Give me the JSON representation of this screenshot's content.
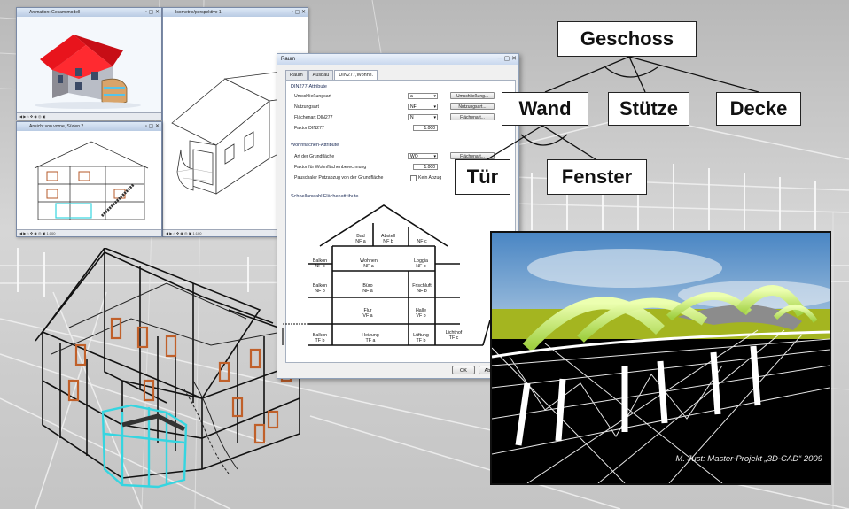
{
  "windows": {
    "top_left_title": "Animation: Gesamtmodell",
    "top_right_title": "Isometrie/perspektive 1",
    "bottom_left_title": "Ansicht von vorne, Süden 2",
    "status_scale": "1:100"
  },
  "dialog": {
    "title": "Raum",
    "tabs": [
      "Raum",
      "Ausbau",
      "DIN277,Wohnfl."
    ],
    "din_section": "DIN277-Attribute",
    "rows": [
      {
        "label": "Umschließungsart",
        "value": "a",
        "button": "Umschließung..."
      },
      {
        "label": "Nutzungsart",
        "value": "NF",
        "button": "Nutzungsart..."
      },
      {
        "label": "Flächenart DIN277",
        "value": "N",
        "button": "Flächenart..."
      },
      {
        "label": "Faktor DIN277",
        "value": "1.000",
        "button": ""
      }
    ],
    "wohn_section": "Wohnflächen-Attribute",
    "wohn_rows": [
      {
        "label": "Art der Grundfläche",
        "value": "WO",
        "button": "Flächenart..."
      },
      {
        "label": "Faktor für Wohnflächenberechnung",
        "value": "1.000",
        "button": ""
      },
      {
        "label": "Pauschaler Putzabzug von der Grundfläche",
        "value": "Kein Abzug",
        "button": ""
      }
    ],
    "schnell_section": "Schnellanwahl Flächenattribute",
    "diagram_labels": [
      {
        "name": "Bad",
        "code": "NF a"
      },
      {
        "name": "Abstell",
        "code": "NF b"
      },
      {
        "name": "",
        "code": "NF c"
      },
      {
        "name": "Balkon",
        "code": "NF c"
      },
      {
        "name": "Wohnen",
        "code": "NF a"
      },
      {
        "name": "Loggia",
        "code": "NF b"
      },
      {
        "name": "Balkon",
        "code": "NF b"
      },
      {
        "name": "Büro",
        "code": "NF a"
      },
      {
        "name": "Frischluft",
        "code": "NF b"
      },
      {
        "name": "Flur",
        "code": "VF a"
      },
      {
        "name": "Halle",
        "code": "VF b"
      },
      {
        "name": "Balkon",
        "code": "TF b"
      },
      {
        "name": "Heizung",
        "code": "TF a"
      },
      {
        "name": "Lüftung",
        "code": "TF b"
      },
      {
        "name": "Lichthof",
        "code": "TF c"
      }
    ],
    "ok": "OK",
    "abbrechen": "Ab"
  },
  "hierarchy": {
    "root": "Geschoss",
    "level1": [
      "Wand",
      "Stütze",
      "Decke"
    ],
    "level2": [
      "Tür",
      "Fenster"
    ]
  },
  "photo_credit": "M. Just: Master-Projekt „3D-CAD“ 2009",
  "colors": {
    "roof": "#e8141c",
    "railing": "#35d5e0",
    "arches": "#c8f070",
    "window_frame": "#c0602a"
  }
}
